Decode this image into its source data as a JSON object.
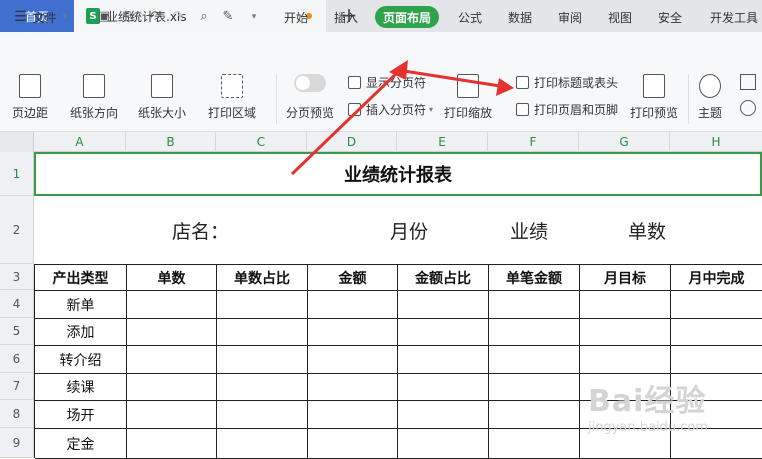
{
  "tabs": {
    "home": "首页",
    "doc_name": "业绩统计表.xls",
    "doc_icon": "S",
    "new_tab": "+"
  },
  "menubar": {
    "file": "文件",
    "items": [
      "开始",
      "插入",
      "页面布局",
      "公式",
      "数据",
      "审阅",
      "视图",
      "安全",
      "开发工具"
    ],
    "active": "页面布局"
  },
  "ribbon": {
    "margins": "页边距",
    "orientation": "纸张方向",
    "size": "纸张大小",
    "print_area": "打印区域",
    "page_break_preview": "分页预览",
    "show_page_break": "显示分页符",
    "insert_page_break": "插入分页符",
    "print_scale": "打印缩放",
    "print_titles": "打印标题或表头",
    "print_header_footer": "打印页眉和页脚",
    "print_preview": "打印预览",
    "theme": "主题"
  },
  "columns": [
    "A",
    "B",
    "C",
    "D",
    "E",
    "F",
    "G",
    "H"
  ],
  "rows": [
    "1",
    "2",
    "3",
    "4",
    "5",
    "6",
    "7",
    "8",
    "9"
  ],
  "sheet": {
    "title": "业绩统计报表",
    "info": {
      "store": "店名：",
      "month": "月份",
      "performance": "业绩",
      "count": "单数"
    },
    "headers": [
      "产出类型",
      "单数",
      "单数占比",
      "金额",
      "金额占比",
      "单笔金额",
      "月目标",
      "月中完成"
    ],
    "types": [
      "新单",
      "添加",
      "转介绍",
      "续课",
      "场开",
      "定金"
    ]
  },
  "watermark": {
    "brand": "Bai经验",
    "url": "jingyan.baidu.com"
  },
  "colors": {
    "accent": "#2fa34b",
    "arrow": "#e5322d",
    "home_tab": "#3f6fcf"
  }
}
